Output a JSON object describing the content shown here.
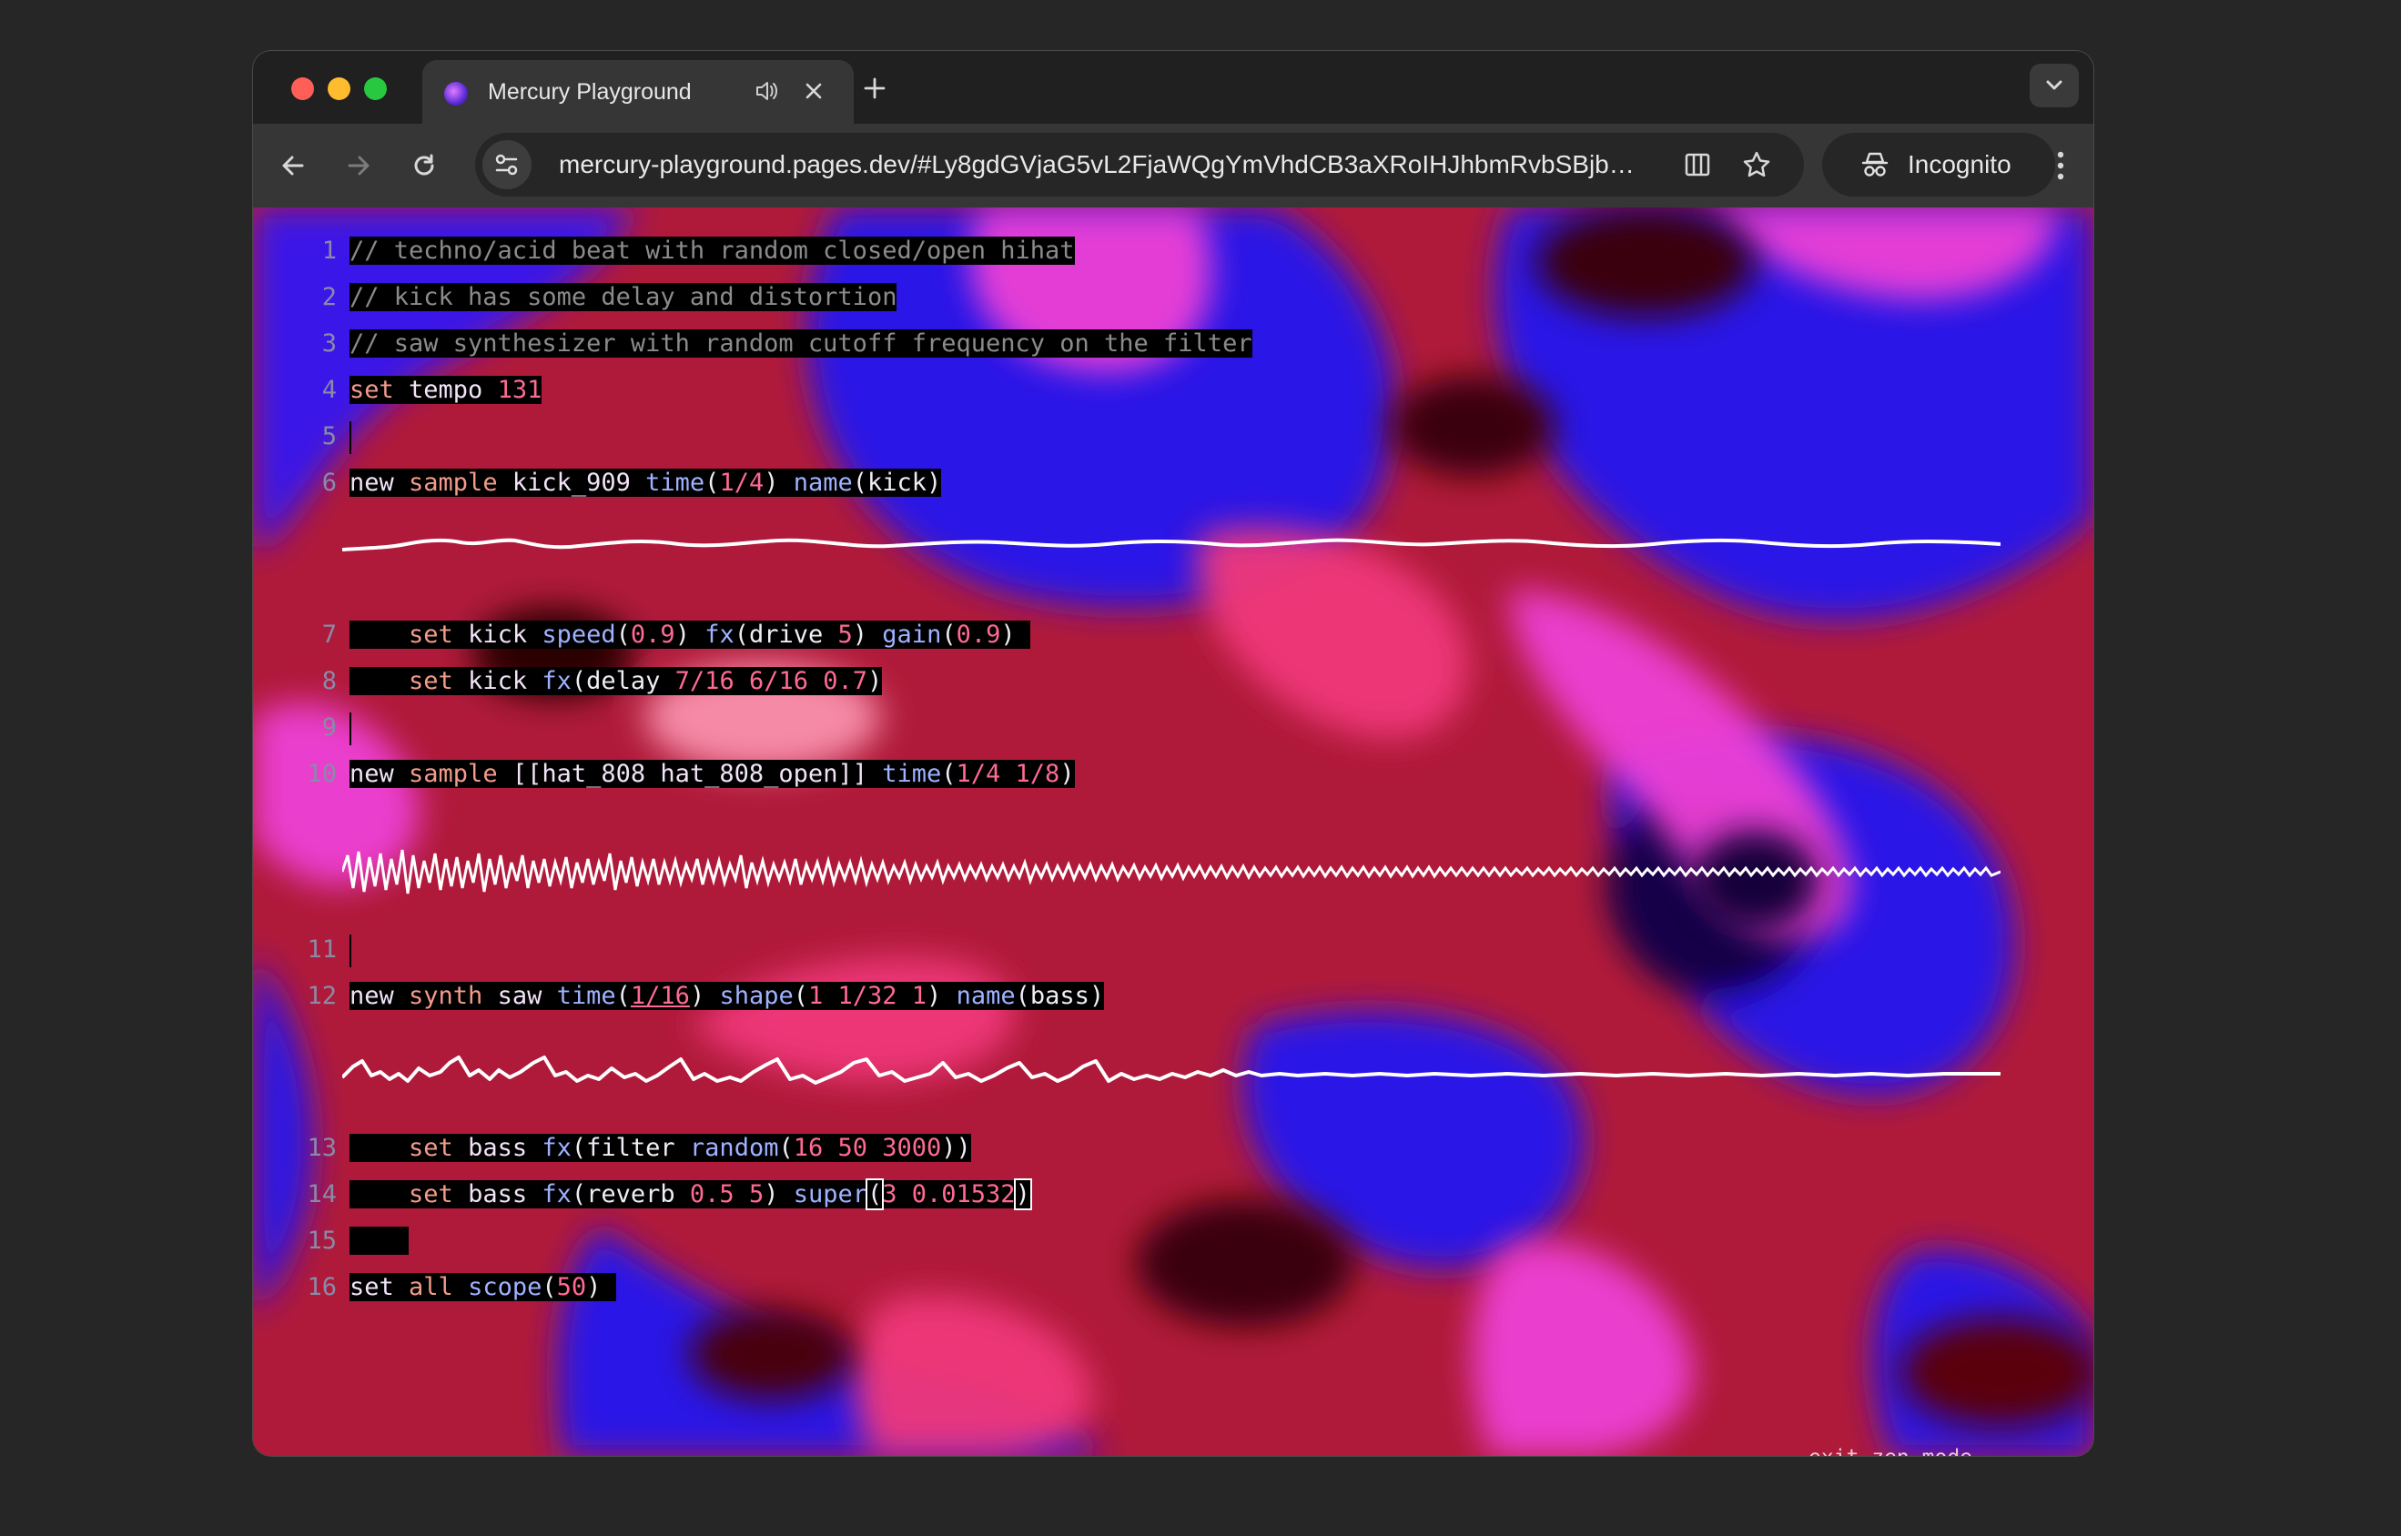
{
  "browser": {
    "tab_title": "Mercury Playground",
    "url": "mercury-playground.pages.dev/#Ly8gdGVjaG5vL2FjaWQgYmVhdCB3aXRoIHJhbmRvbSBjb…",
    "incognito_label": "Incognito",
    "icons": [
      "back-arrow-icon",
      "forward-arrow-icon",
      "reload-icon",
      "site-settings-icon",
      "reader-mode-icon",
      "bookmark-star-icon",
      "incognito-icon",
      "more-menu-icon",
      "audio-icon",
      "close-icon",
      "plus-icon",
      "chevron-down-icon"
    ]
  },
  "editor": {
    "line_numbers": [
      "1",
      "2",
      "3",
      "4",
      "5",
      "6",
      "7",
      "8",
      "9",
      "10",
      "11",
      "12",
      "13",
      "14",
      "15",
      "16"
    ],
    "lines": {
      "l1": "// techno/acid beat with random closed/open hihat",
      "l2": "// kick has some delay and distortion",
      "l3": "// saw synthesizer with random cutoff frequency on the filter",
      "l4": [
        "set",
        " tempo ",
        "131"
      ],
      "l6": [
        "new",
        " sample ",
        "kick_909 ",
        "time",
        "(",
        "1/4",
        ") ",
        "name",
        "(kick)"
      ],
      "l7": [
        "    ",
        "set",
        " kick ",
        "speed",
        "(",
        "0.9",
        ") ",
        "fx",
        "(drive ",
        "5",
        ") ",
        "gain",
        "(",
        "0.9",
        ") "
      ],
      "l8": [
        "    ",
        "set",
        " kick ",
        "fx",
        "(delay ",
        "7/16 6/16 0.7",
        ")"
      ],
      "l10": [
        "new",
        " sample ",
        "[[hat_808 hat_808_open]] ",
        "time",
        "(",
        "1/4 1/8",
        ")"
      ],
      "l12": [
        "new",
        " synth ",
        "saw ",
        "time",
        "(",
        "1/16",
        ") ",
        "shape",
        "(",
        "1 1/32 1",
        ") ",
        "name",
        "(bass)"
      ],
      "l13": [
        "    ",
        "set",
        " bass ",
        "fx",
        "(filter ",
        "random",
        "(",
        "16 50 3000",
        "))"
      ],
      "l14": [
        "    ",
        "set",
        " bass ",
        "fx",
        "(reverb ",
        "0.5 5",
        ") ",
        "super",
        "(",
        "3 0.01532",
        ")"
      ],
      "l16": [
        "set",
        " all ",
        "scope",
        "(",
        "50",
        ") "
      ]
    }
  },
  "zen_mode_label": "exit zen mode",
  "colors": {
    "background_red": "#b01a3a",
    "background_blue": "#2a12e6",
    "background_magenta": "#ee3fd6",
    "background_dark": "#2a0006",
    "scope_line": "#ffffff"
  }
}
